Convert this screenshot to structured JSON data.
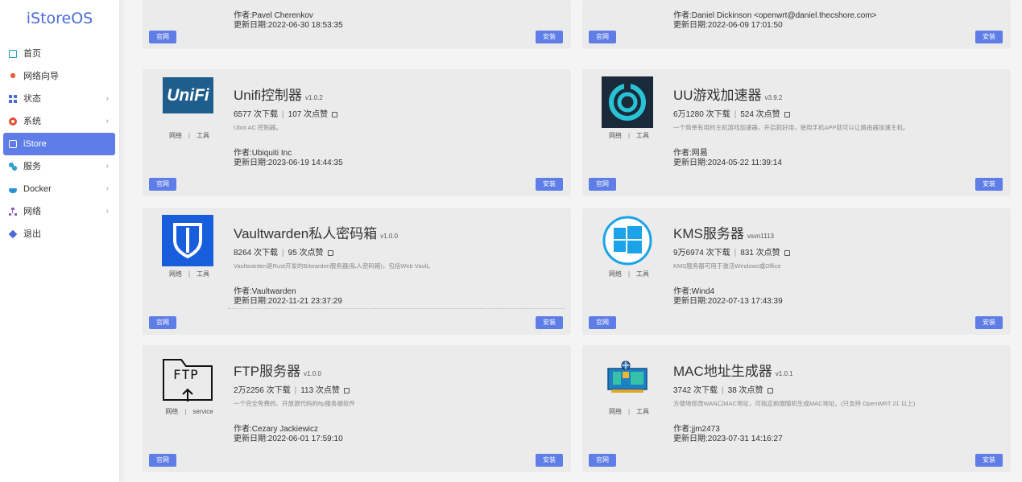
{
  "brand": "iStoreOS",
  "nav": [
    {
      "label": "首页",
      "icon": "home-icon"
    },
    {
      "label": "网络向导",
      "icon": "wizard-icon"
    },
    {
      "label": "状态",
      "icon": "status-icon",
      "chevron": "›"
    },
    {
      "label": "系统",
      "icon": "system-icon",
      "chevron": "›"
    },
    {
      "label": "iStore",
      "icon": "istore-icon",
      "active": true
    },
    {
      "label": "服务",
      "icon": "services-icon",
      "chevron": "›"
    },
    {
      "label": "Docker",
      "icon": "docker-icon",
      "chevron": "›"
    },
    {
      "label": "网络",
      "icon": "network-icon",
      "chevron": "›"
    },
    {
      "label": "退出",
      "icon": "logout-icon"
    }
  ],
  "buttons": {
    "home": "官网",
    "install": "安装"
  },
  "apps": [
    {
      "author": "作者:Pavel Cherenkov",
      "updated": "更新日期:2022-06-30 18:53:35"
    },
    {
      "author": "作者:Daniel Dickinson <openwrt@daniel.thecshore.com>",
      "updated": "更新日期:2022-06-09 17:01:50"
    },
    {
      "title": "Unifi控制器",
      "version": "v1.0.2",
      "downloads": "6577 次下载",
      "likes": "107 次点赞",
      "desc": "Ubnt AC 控制器。",
      "tag1": "网络",
      "tag2": "工具",
      "author": "作者:Ubiquiti Inc",
      "updated": "更新日期:2023-06-19 14:44:35",
      "logo_text": "UniFi",
      "logo_icon": "unifi-logo-icon"
    },
    {
      "title": "UU游戏加速器",
      "version": "v3.9.2",
      "downloads": "6万1280 次下载",
      "likes": "524 次点赞",
      "desc": "一个简单有用的主机游戏加速器，开启就好用，使用手机APP就可以让路由器加速主机。",
      "tag1": "网络",
      "tag2": "工具",
      "author": "作者:网易",
      "updated": "更新日期:2024-05-22 11:39:14",
      "logo_icon": "uu-logo-icon"
    },
    {
      "title": "Vaultwarden私人密码箱",
      "version": "v1.0.0",
      "downloads": "8264 次下载",
      "likes": "95 次点赞",
      "desc": "Vaultwarden是Rust开发的Bitwarden服务器(私人密码箱)，包括Web Vault。",
      "tag1": "网络",
      "tag2": "工具",
      "author": "作者:Vaultwarden",
      "updated": "更新日期:2022-11-21 23:37:29",
      "logo_icon": "vaultwarden-logo-icon"
    },
    {
      "title": "KMS服务器",
      "version": "vsvn1113",
      "downloads": "9万6974 次下载",
      "likes": "831 次点赞",
      "desc": "KMS服务器可用于激活Windows或Office",
      "tag1": "网络",
      "tag2": "工具",
      "author": "作者:Wind4",
      "updated": "更新日期:2022-07-13 17:43:39",
      "logo_icon": "kms-windows-logo-icon"
    },
    {
      "title": "FTP服务器",
      "version": "v1.0.0",
      "downloads": "2万2256 次下载",
      "likes": "113 次点赞",
      "desc": "一个完全免费的、开放源代码的ftp服务端软件",
      "tag1": "网络",
      "tag2": "service",
      "author": "作者:Cezary Jackiewicz",
      "updated": "更新日期:2022-06-01 17:59:10",
      "logo_text": "FTP",
      "logo_icon": "ftp-logo-icon"
    },
    {
      "title": "MAC地址生成器",
      "version": "v1.0.1",
      "downloads": "3742 次下载",
      "likes": "38 次点赞",
      "desc": "方便地修改WAN口MAC地址，可指定前缀随机生成MAC地址。(只支持 OpenWRT 21 以上)",
      "tag1": "网络",
      "tag2": "工具",
      "author": "作者:jjm2473",
      "updated": "更新日期:2023-07-31 14:16:27",
      "logo_icon": "network-card-logo-icon"
    }
  ]
}
